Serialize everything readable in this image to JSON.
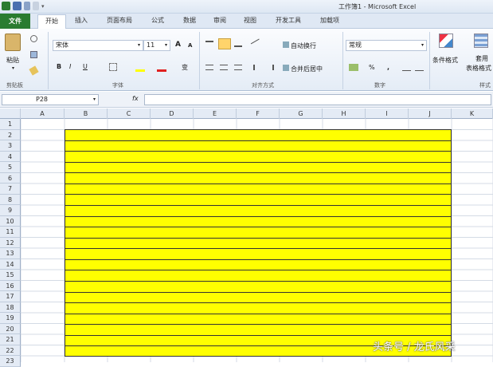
{
  "window": {
    "title": "工作簿1 - Microsoft Excel"
  },
  "tabs": {
    "file": "文件",
    "home": "开始",
    "insert": "插入",
    "page_layout": "页面布局",
    "formulas": "公式",
    "data": "数据",
    "review": "审阅",
    "view": "视图",
    "developer": "开发工具",
    "addins": "加载项"
  },
  "ribbon": {
    "clipboard": {
      "paste_label": "粘贴",
      "group_label": "剪贴板"
    },
    "font": {
      "font_name": "宋体",
      "font_size": "11",
      "group_label": "字体",
      "bold": "B",
      "italic": "I",
      "underline": "U",
      "grow": "A",
      "shrink": "A",
      "phonetic": "变"
    },
    "alignment": {
      "wrap_text": "自动换行",
      "merge_center": "合并后居中",
      "group_label": "对齐方式"
    },
    "number": {
      "format": "常规",
      "percent": "%",
      "comma": ",",
      "group_label": "数字"
    },
    "styles": {
      "conditional": "条件格式",
      "table_format_line1": "套用",
      "table_format_line2": "表格格式",
      "group_label": "样式"
    }
  },
  "formula_bar": {
    "name_box": "P28",
    "fx": "fx",
    "value": ""
  },
  "columns": [
    "A",
    "B",
    "C",
    "D",
    "E",
    "F",
    "G",
    "H",
    "I",
    "J",
    "K"
  ],
  "rows": [
    "1",
    "2",
    "3",
    "4",
    "5",
    "6",
    "7",
    "8",
    "9",
    "10",
    "11",
    "12",
    "13",
    "14",
    "15",
    "16",
    "17",
    "18",
    "19",
    "20",
    "21",
    "22",
    "23"
  ],
  "highlight": {
    "fill_color": "#ffff00",
    "border_color": "#333333",
    "range": "B2:J22"
  },
  "watermark": "头条号 / 龙氏风采"
}
